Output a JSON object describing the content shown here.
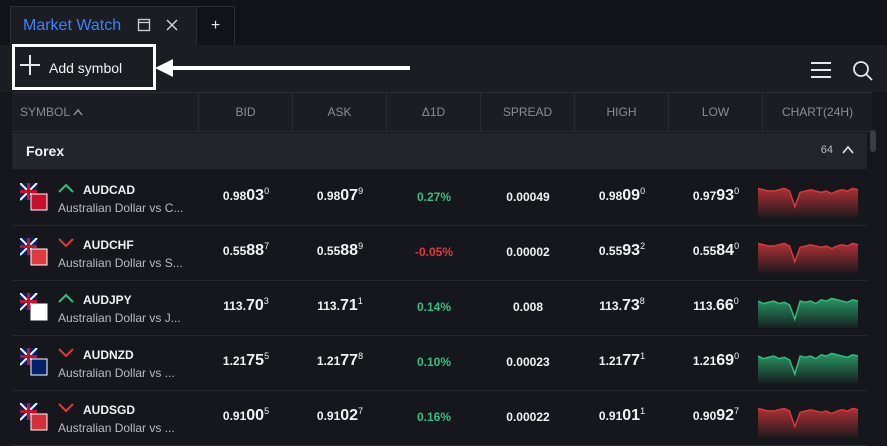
{
  "tab": {
    "title": "Market Watch"
  },
  "toolbar": {
    "add_label": "Add symbol"
  },
  "columns": [
    "SYMBOL",
    "BID",
    "ASK",
    "Δ1D",
    "SPREAD",
    "HIGH",
    "LOW",
    "CHART(24H)"
  ],
  "group": {
    "title": "Forex",
    "count": "64"
  },
  "colors": {
    "accent": "#3a82ff",
    "up": "#2ec27e",
    "down": "#e0393e"
  },
  "rows": [
    {
      "symbol": "AUDCAD",
      "desc": "Australian Dollar vs C...",
      "trend": "up",
      "bid": [
        "0.98",
        "03",
        "0"
      ],
      "ask": [
        "0.98",
        "07",
        "9"
      ],
      "change": "0.27%",
      "change_dir": "up",
      "spread": "0.00049",
      "high": [
        "0.98",
        "09",
        "0"
      ],
      "low": [
        "0.97",
        "93",
        "0"
      ],
      "chart": "down"
    },
    {
      "symbol": "AUDCHF",
      "desc": "Australian Dollar vs S...",
      "trend": "down",
      "bid": [
        "0.55",
        "88",
        "7"
      ],
      "ask": [
        "0.55",
        "88",
        "9"
      ],
      "change": "-0.05%",
      "change_dir": "down",
      "spread": "0.00002",
      "high": [
        "0.55",
        "93",
        "2"
      ],
      "low": [
        "0.55",
        "84",
        "0"
      ],
      "chart": "down"
    },
    {
      "symbol": "AUDJPY",
      "desc": "Australian Dollar vs J...",
      "trend": "up",
      "bid": [
        "113.",
        "70",
        "3"
      ],
      "ask": [
        "113.",
        "71",
        "1"
      ],
      "change": "0.14%",
      "change_dir": "up",
      "spread": "0.008",
      "high": [
        "113.",
        "73",
        "8"
      ],
      "low": [
        "113.",
        "66",
        "0"
      ],
      "chart": "up"
    },
    {
      "symbol": "AUDNZD",
      "desc": "Australian Dollar vs ...",
      "trend": "down",
      "bid": [
        "1.21",
        "75",
        "5"
      ],
      "ask": [
        "1.21",
        "77",
        "8"
      ],
      "change": "0.10%",
      "change_dir": "up",
      "spread": "0.00023",
      "high": [
        "1.21",
        "77",
        "1"
      ],
      "low": [
        "1.21",
        "69",
        "0"
      ],
      "chart": "up"
    },
    {
      "symbol": "AUDSGD",
      "desc": "Australian Dollar vs ...",
      "trend": "down",
      "bid": [
        "0.91",
        "00",
        "5"
      ],
      "ask": [
        "0.91",
        "02",
        "7"
      ],
      "change": "0.16%",
      "change_dir": "up",
      "spread": "0.00022",
      "high": [
        "0.91",
        "01",
        "1"
      ],
      "low": [
        "0.90",
        "92",
        "7"
      ],
      "chart": "down"
    }
  ]
}
